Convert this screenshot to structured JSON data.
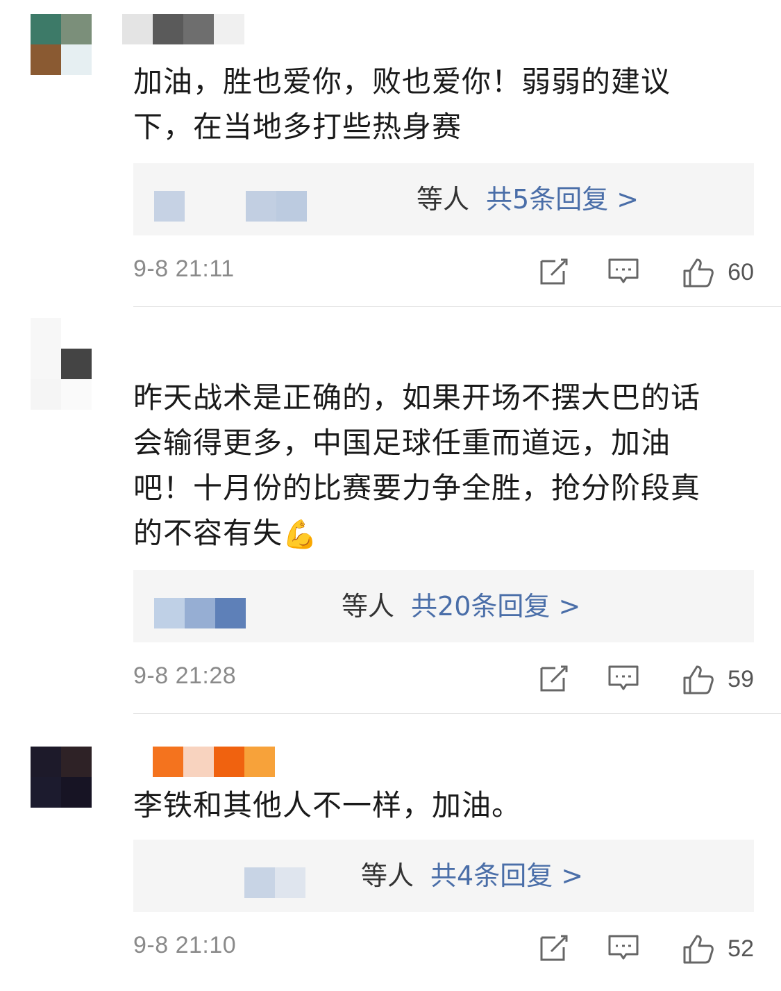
{
  "comments": [
    {
      "body_line1": "加油，胜也爱你，败也爱你！弱弱的建议",
      "body_line2": "下，在当地多打些热身赛",
      "reply_who": "等人",
      "reply_count": "共5条回复 >",
      "timestamp": "9-8 21:11",
      "likes": "60",
      "avatar_colors": [
        "#3d7a68",
        "#7b8f7a",
        "#8a5a32",
        "#e6eff2"
      ],
      "username_colors": [
        "#e4e4e4",
        "#5a5a5a",
        "#6e6e6e",
        "#f0f0f0"
      ],
      "reply_name_colors": [
        "#c6d2e4",
        "#c2cfe2",
        "#bccbe0"
      ]
    },
    {
      "body_line1": "昨天战术是正确的，如果开场不摆大巴的话",
      "body_line2": "会输得更多，中国足球任重而道远，加油",
      "body_line3": "吧！十月份的比赛要力争全胜，抢分阶段真",
      "body_line4": "的不容有失",
      "emoji": "💪",
      "reply_who": "等人",
      "reply_count": "共20条回复 >",
      "timestamp": "9-8 21:28",
      "likes": "59",
      "avatar_colors": [
        "#f7f7f7",
        "#444444",
        "#f2f2f2",
        "#fafafa"
      ],
      "reply_name_colors": [
        "#bfd0e6",
        "#96aed3",
        "#5e80b8"
      ]
    },
    {
      "body_line1": "李铁和其他人不一样，加油。",
      "reply_who": "等人",
      "reply_count": "共4条回复 >",
      "timestamp": "9-8 21:10",
      "likes": "52",
      "avatar_colors": [
        "#1d1a2a",
        "#2e2226",
        "#1c1b2e",
        "#171424"
      ],
      "username_colors": [
        "#f4731e",
        "#f8d3bf",
        "#f0620f",
        "#f7a23a"
      ],
      "reply_name_colors": [
        "#c8d4e5",
        "#dfe5ee"
      ]
    }
  ],
  "accent_color": "#4a6ea8",
  "icons": [
    "edit-icon",
    "comment-icon",
    "thumbs-up-icon"
  ]
}
